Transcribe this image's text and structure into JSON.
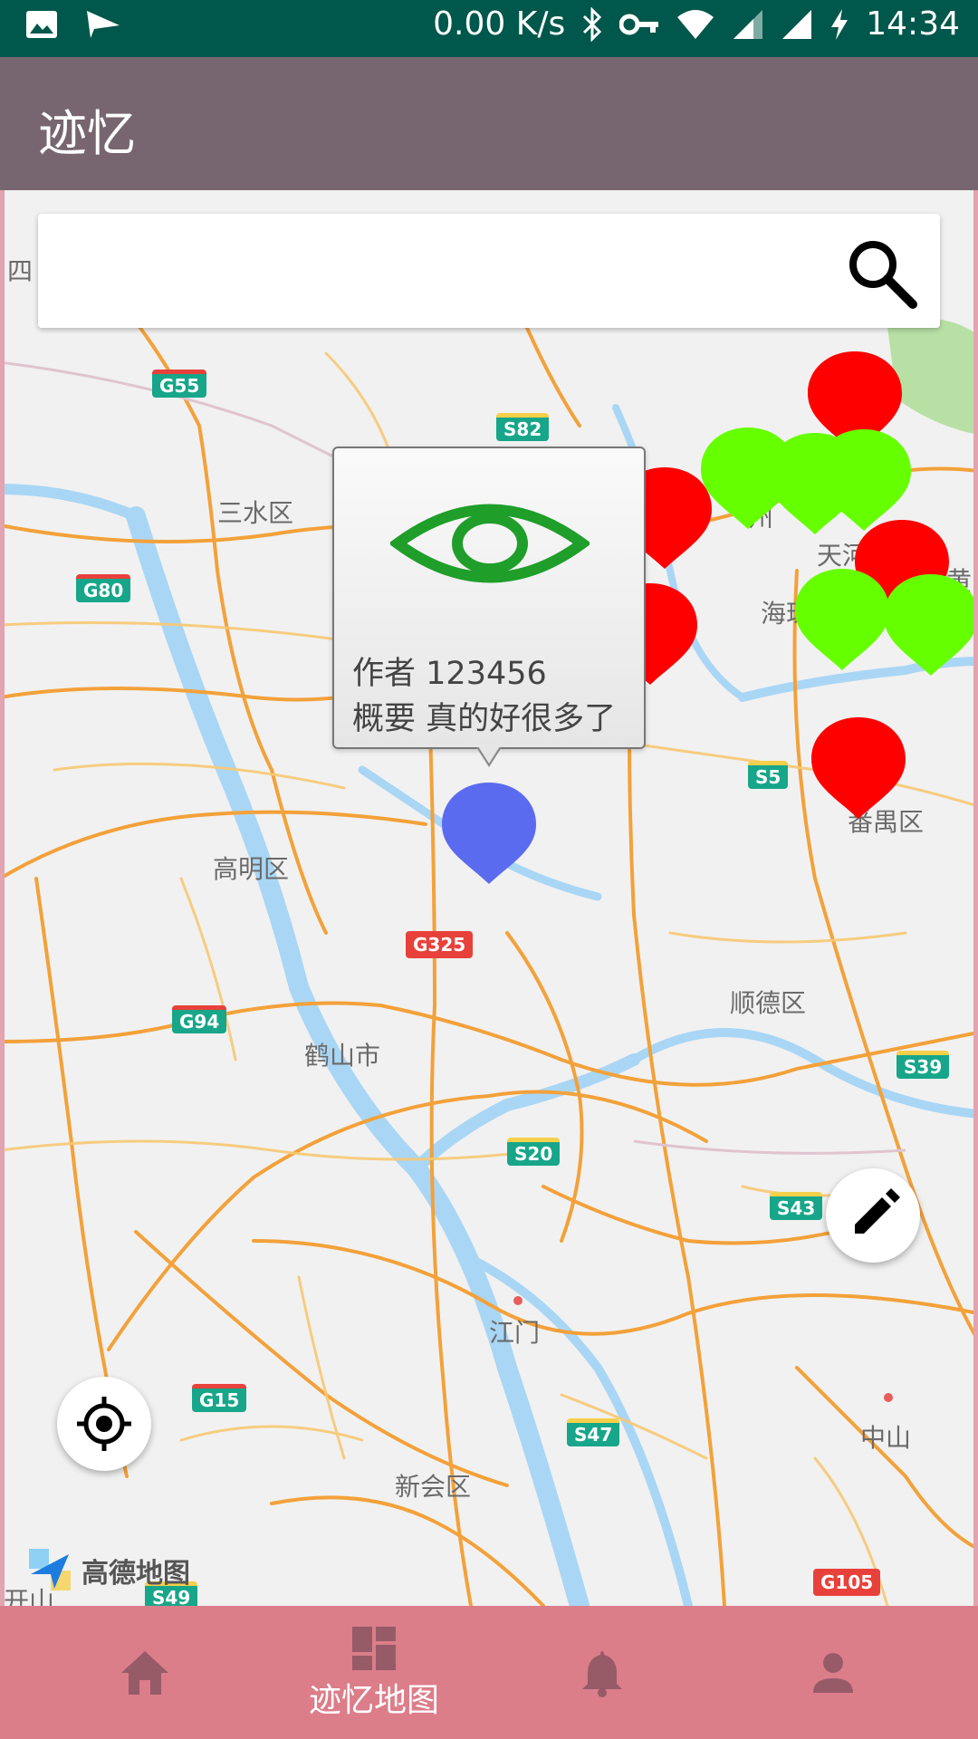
{
  "status_bar": {
    "net_speed": "0.00 K/s",
    "time": "14:34",
    "icons": [
      "image-icon",
      "send-icon",
      "bluetooth-icon",
      "vpn-key-icon",
      "wifi-icon",
      "signal-icon",
      "signal-icon",
      "charging-icon"
    ]
  },
  "app_bar": {
    "title": "迹忆"
  },
  "search": {
    "value": "",
    "placeholder": "",
    "icon": "search-icon"
  },
  "map": {
    "provider_logo": "高德地图",
    "place_labels": [
      "四",
      "三水区",
      "高明区",
      "鹤山市",
      "江门",
      "新会区",
      "顺德区",
      "番禺区",
      "中山",
      "天河",
      "海珠",
      "州",
      "黄",
      "开山"
    ],
    "road_shields": [
      "G55",
      "S82",
      "G80",
      "S5",
      "G325",
      "G94",
      "S39",
      "S20",
      "S43",
      "G15",
      "S47",
      "G105",
      "S49"
    ]
  },
  "popup": {
    "icon": "eye-icon",
    "author_label": "作者",
    "author_value": "123456",
    "summary_label": "概要",
    "summary_value": "真的好很多了"
  },
  "markers": {
    "colors": {
      "red": "#ff0000",
      "green": "#66ff00",
      "selected": "#5b6bf0"
    },
    "red_count": 6,
    "green_count": 6,
    "selected_count": 1
  },
  "fab": {
    "edit_icon": "edit-icon",
    "locate_icon": "my-location-icon"
  },
  "bottom_nav": {
    "items": [
      {
        "icon": "home-icon",
        "label": ""
      },
      {
        "icon": "dashboard-icon",
        "label": "迹忆地图"
      },
      {
        "icon": "notifications-icon",
        "label": ""
      },
      {
        "icon": "person-icon",
        "label": ""
      }
    ],
    "active_index": 1
  },
  "colors": {
    "status_bar": "#00574b",
    "app_bar": "#776670",
    "bottom_nav": "#dc7d8a"
  }
}
